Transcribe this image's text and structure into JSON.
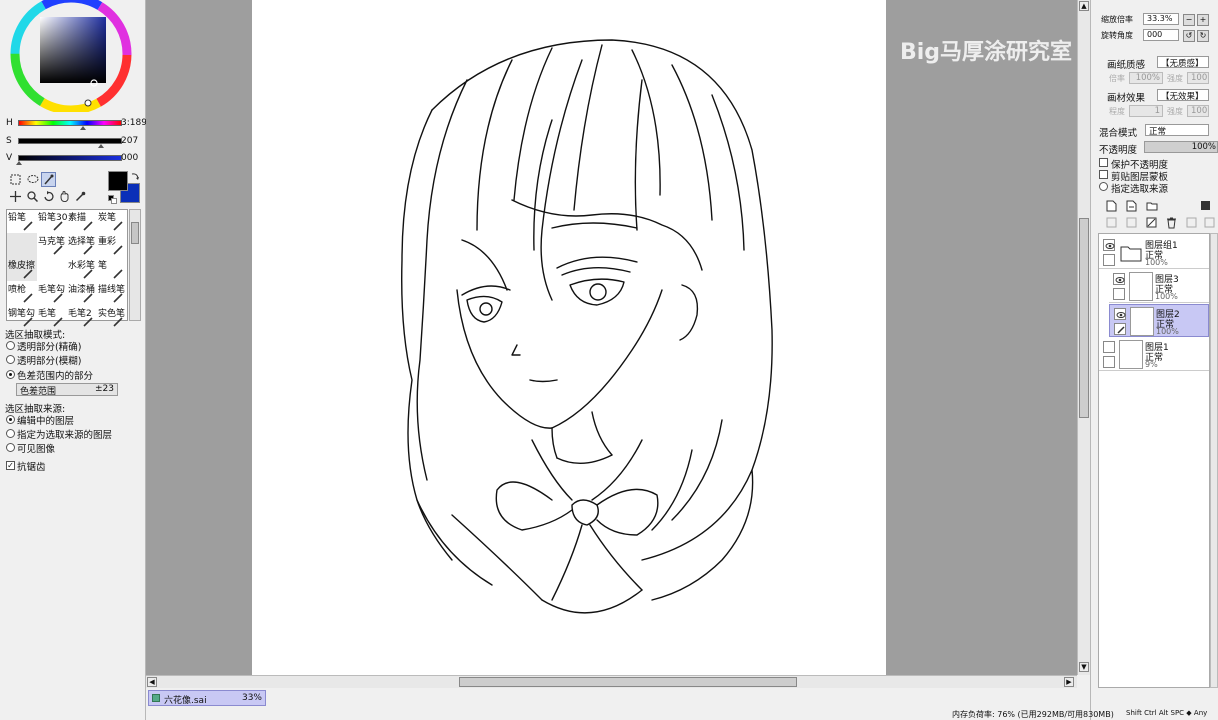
{
  "app": {
    "watermark": "Big马厚涂研究室"
  },
  "color_panel": {
    "sliders": [
      {
        "label": "H",
        "value": "3:189"
      },
      {
        "label": "S",
        "value": "207"
      },
      {
        "label": "V",
        "value": "000"
      }
    ],
    "foreground": "#000000",
    "background": "#0a2fb8"
  },
  "brushes": [
    {
      "name": "铅笔"
    },
    {
      "name": "铅笔30"
    },
    {
      "name": "素描"
    },
    {
      "name": "炭笔"
    },
    {
      "name": ""
    },
    {
      "name": "马克笔"
    },
    {
      "name": "选择笔"
    },
    {
      "name": "重彩"
    },
    {
      "name": "橡皮擦"
    },
    {
      "name": ""
    },
    {
      "name": "水彩笔"
    },
    {
      "name": "笔"
    },
    {
      "name": "喷枪"
    },
    {
      "name": "毛笔勾"
    },
    {
      "name": "油漆桶"
    },
    {
      "name": "描线笔"
    },
    {
      "name": "钢笔勾"
    },
    {
      "name": "毛笔"
    },
    {
      "name": "毛笔2"
    },
    {
      "name": "实色笔"
    }
  ],
  "selection_options": {
    "mode_title": "选区抽取模式:",
    "modes": [
      "透明部分(精确)",
      "透明部分(模糊)",
      "色差范围内的部分"
    ],
    "range_label": "色差范围",
    "range_value": "±23",
    "source_title": "选区抽取来源:",
    "sources": [
      "编辑中的图层",
      "指定为选取来源的图层",
      "可见图像"
    ],
    "antialias": "抗锯齿"
  },
  "document": {
    "tab_name": "六花像.sai",
    "tab_zoom": "33%"
  },
  "right_panel": {
    "zoom_label": "缩放倍率",
    "zoom_value": "33.3%",
    "angle_label": "旋转角度",
    "angle_value": "000",
    "texture_label": "画纸质感",
    "texture_value": "【无质感】",
    "texture_sub": "倍率",
    "texture_sub_val": "100%",
    "texture_str": "强度",
    "texture_str_val": "100",
    "effect_label": "画材效果",
    "effect_value": "【无效果】",
    "effect_sub": "程度",
    "effect_sub_val": "1",
    "effect_str": "强度",
    "effect_str_val": "100",
    "blend_label": "混合模式",
    "blend_value": "正常",
    "opacity_label": "不透明度",
    "opacity_value": "100%",
    "checks": [
      "保护不透明度",
      "剪贴图层蒙板",
      "指定选取来源"
    ]
  },
  "layers": [
    {
      "name": "图层组1",
      "mode": "正常",
      "opacity": "100%",
      "group": true,
      "selected": false
    },
    {
      "name": "图层3",
      "mode": "正常",
      "opacity": "100%",
      "group": false,
      "selected": false
    },
    {
      "name": "图层2",
      "mode": "正常",
      "opacity": "100%",
      "group": false,
      "selected": true
    },
    {
      "name": "图层1",
      "mode": "正常",
      "opacity": "9%",
      "group": false,
      "selected": false
    }
  ],
  "status": {
    "memory": "内存负荷率: 76% (已用292MB/可用830MB)",
    "keys": "Shift Ctrl Alt SPC ◆ Any"
  }
}
